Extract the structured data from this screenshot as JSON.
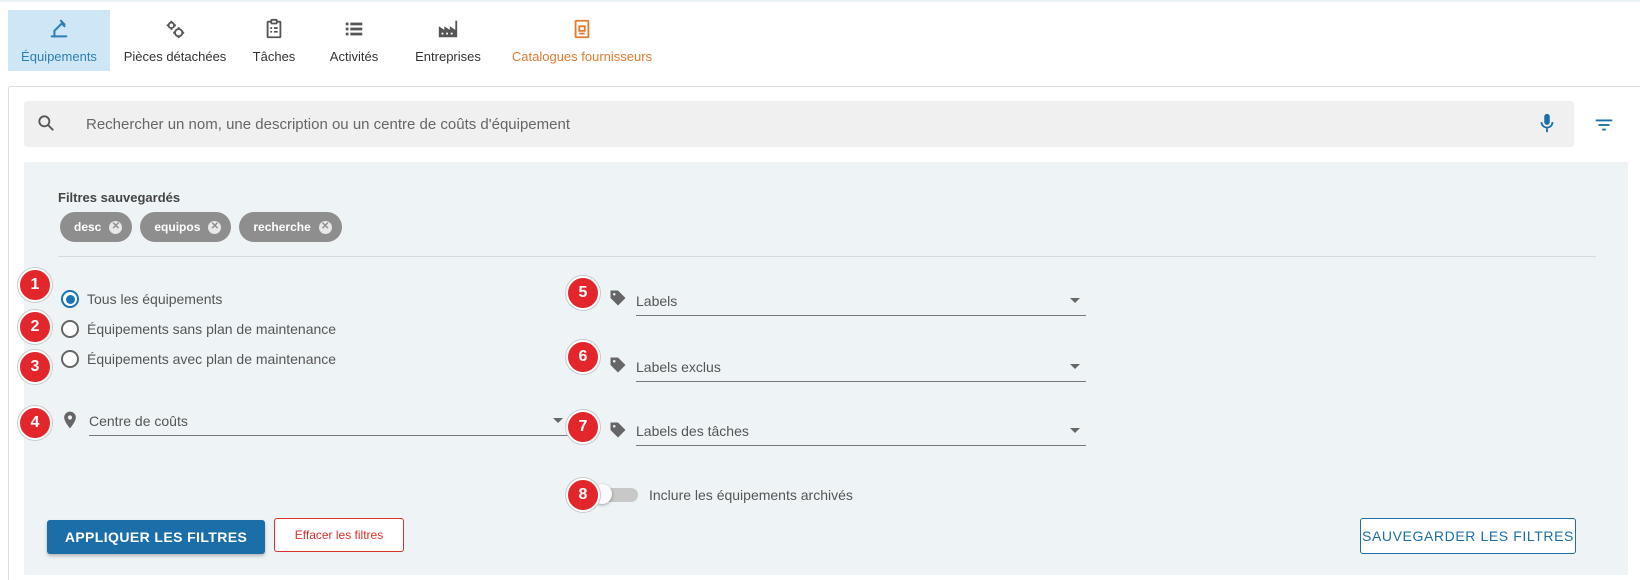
{
  "nav": {
    "items": [
      {
        "label": "Équipements",
        "icon": "equipment-icon",
        "active": true
      },
      {
        "label": "Pièces détachées",
        "icon": "gears-icon"
      },
      {
        "label": "Tâches",
        "icon": "clipboard-icon"
      },
      {
        "label": "Activités",
        "icon": "list-icon"
      },
      {
        "label": "Entreprises",
        "icon": "factory-icon"
      },
      {
        "label": "Catalogues fournisseurs",
        "icon": "catalog-icon",
        "highlight": true
      }
    ]
  },
  "search": {
    "placeholder": "Rechercher un nom, une description ou un centre de coûts d'équipement",
    "value": ""
  },
  "saved_filters": {
    "title": "Filtres sauvegardés",
    "chips": [
      "desc",
      "equipos",
      "recherche"
    ]
  },
  "equipment_scope": {
    "options": [
      {
        "label": "Tous les équipements",
        "checked": true
      },
      {
        "label": "Équipements sans plan de maintenance",
        "checked": false
      },
      {
        "label": "Équipements avec plan de maintenance",
        "checked": false
      }
    ]
  },
  "fields": {
    "cost_center": "Centre de coûts",
    "labels": "Labels",
    "excluded_labels": "Labels exclus",
    "task_labels": "Labels des tâches"
  },
  "archived_toggle": {
    "label": "Inclure les équipements archivés",
    "on": false
  },
  "badges": [
    "1",
    "2",
    "3",
    "4",
    "5",
    "6",
    "7",
    "8"
  ],
  "buttons": {
    "apply": "APPLIQUER LES FILTRES",
    "clear": "Effacer les filtres",
    "save": "SAUVEGARDER LES FILTRES"
  },
  "colors": {
    "primary": "#1b6ea7",
    "active_tab_bg": "#cfe6f6",
    "highlight": "#e07b32",
    "danger": "#d9302c",
    "badge": "#e3262c",
    "filters_bg": "#eef4f6"
  }
}
